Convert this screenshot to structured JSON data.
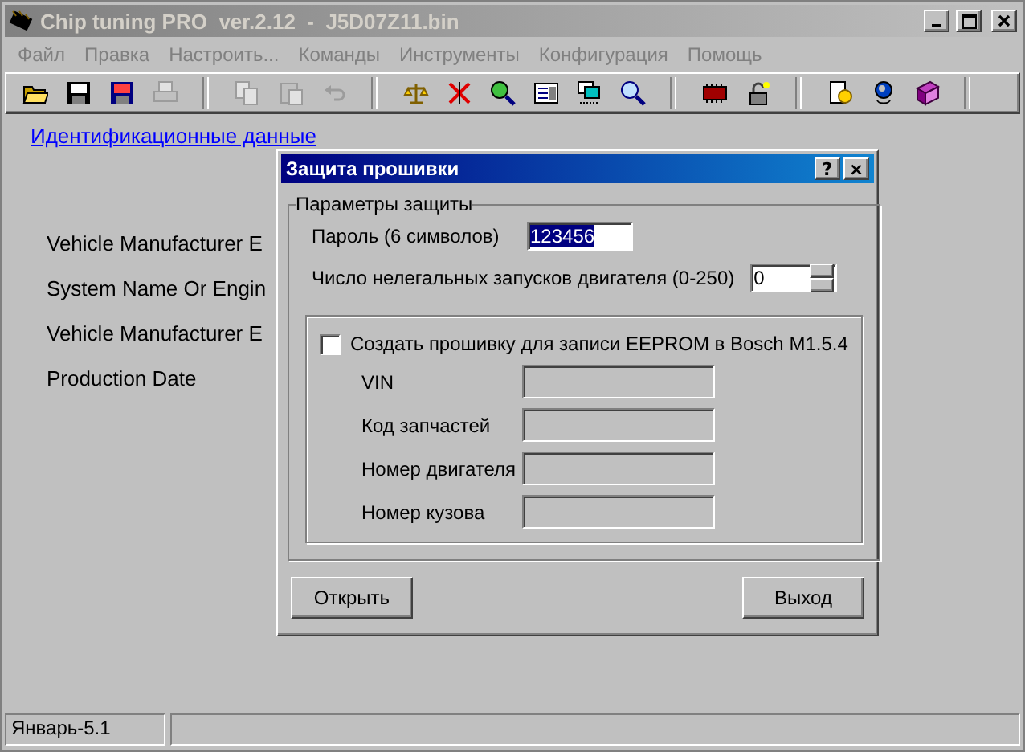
{
  "window": {
    "title": "Chip tuning PRO  ver.2.12  -  J5D07Z11.bin",
    "active": false
  },
  "menu": [
    {
      "label": "Файл",
      "disabled": true
    },
    {
      "label": "Правка",
      "disabled": true
    },
    {
      "label": "Настроить...",
      "disabled": true
    },
    {
      "label": "Команды",
      "disabled": true
    },
    {
      "label": "Инструменты",
      "disabled": true
    },
    {
      "label": "Конфигурация",
      "disabled": true
    },
    {
      "label": "Помощь",
      "disabled": true
    }
  ],
  "toolbar_groups": [
    [
      {
        "disabled": false
      },
      {
        "disabled": false
      },
      {
        "disabled": false
      },
      {
        "disabled": true
      }
    ],
    [
      {
        "disabled": true
      },
      {
        "disabled": true
      },
      {
        "disabled": true
      }
    ],
    [
      {
        "disabled": false
      },
      {
        "disabled": false
      },
      {
        "disabled": false
      },
      {
        "disabled": false
      },
      {
        "disabled": false
      },
      {
        "disabled": false
      }
    ],
    [
      {
        "disabled": false
      },
      {
        "disabled": false
      }
    ],
    [
      {
        "disabled": false
      },
      {
        "disabled": false
      },
      {
        "disabled": false
      }
    ]
  ],
  "main": {
    "link": "Идентификационные данные",
    "labels": [
      "Vehicle Manufacturer E",
      "System Name Or Engin",
      "Vehicle Manufacturer E",
      "Production Date"
    ]
  },
  "dialog": {
    "title": "Защита прошивки",
    "help_button": "?",
    "close_button": "×",
    "group": {
      "title": "Параметры защиты",
      "password": {
        "label": "Пароль (6 символов)",
        "value": "123456",
        "selected": true
      },
      "launches": {
        "label": "Число нелегальных запусков двигателя (0-250)",
        "value": "0"
      },
      "eeprom": {
        "label": "Создать прошивку для записи EEPROM в Bosch M1.5.4",
        "checked": false,
        "fields": [
          {
            "label": "VIN",
            "disabled": true
          },
          {
            "label": "Код запчастей",
            "disabled": true
          },
          {
            "label": "Номер двигателя",
            "disabled": true
          },
          {
            "label": "Номер кузова",
            "disabled": true
          }
        ]
      }
    },
    "buttons": [
      "Открыть",
      "Выход"
    ]
  },
  "status_bar": [
    "Январь-5.1"
  ]
}
